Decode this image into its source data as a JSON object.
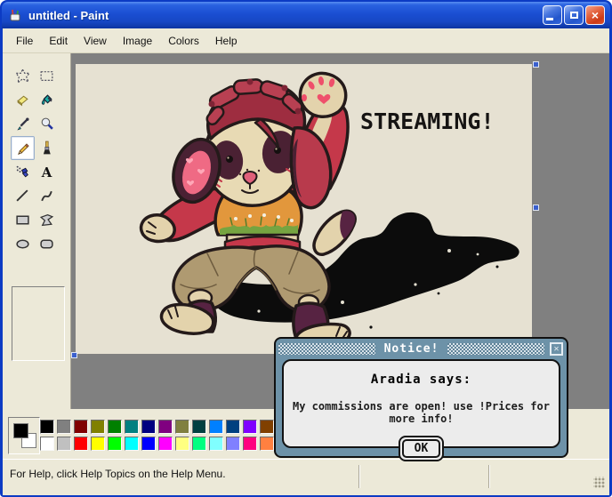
{
  "window": {
    "title": "untitled - Paint",
    "app_icon": "paint-cup-icon",
    "controls": {
      "minimize": "minimize",
      "maximize": "maximize",
      "close": "close"
    }
  },
  "menu": {
    "items": [
      "File",
      "Edit",
      "View",
      "Image",
      "Colors",
      "Help"
    ]
  },
  "tools": {
    "selected_tool": "pencil",
    "items": [
      {
        "icon": "free-form-select-icon"
      },
      {
        "icon": "select-icon"
      },
      {
        "icon": "eraser-icon"
      },
      {
        "icon": "fill-with-color-icon"
      },
      {
        "icon": "pick-color-icon"
      },
      {
        "icon": "magnifier-icon"
      },
      {
        "icon": "pencil-icon"
      },
      {
        "icon": "brush-icon"
      },
      {
        "icon": "airbrush-icon"
      },
      {
        "icon": "text-icon"
      },
      {
        "icon": "line-icon"
      },
      {
        "icon": "curve-icon"
      },
      {
        "icon": "rectangle-icon"
      },
      {
        "icon": "polygon-icon"
      },
      {
        "icon": "ellipse-icon"
      },
      {
        "icon": "rounded-rectangle-icon"
      }
    ]
  },
  "canvas": {
    "overlay_text": "STREAMING!",
    "background": "#e6e1d2",
    "artwork": "anthro dog character waving with heart paw pad, orange crop top, khaki pants, black shadow"
  },
  "palette": {
    "foreground": "#000000",
    "background": "#ffffff",
    "row1": [
      "#000000",
      "#808080",
      "#800000",
      "#808000",
      "#008000",
      "#008080",
      "#000080",
      "#800080",
      "#808040",
      "#004040",
      "#0080ff",
      "#004080",
      "#8000ff",
      "#804000"
    ],
    "row2": [
      "#ffffff",
      "#c0c0c0",
      "#ff0000",
      "#ffff00",
      "#00ff00",
      "#00ffff",
      "#0000ff",
      "#ff00ff",
      "#ffff80",
      "#00ff80",
      "#80ffff",
      "#8080ff",
      "#ff0080",
      "#ff8040"
    ]
  },
  "dialog": {
    "title": "Notice!",
    "close_glyph": "✕",
    "heading": "Aradia says:",
    "message": "My commissions are open! use !Prices for more info!",
    "ok_label": "OK"
  },
  "status_bar": {
    "text": "For Help, click Help Topics on the Help Menu."
  },
  "colors": {
    "titlebar_blue": "#1a4ed2",
    "window_border_blue": "#0c3bc4",
    "chrome_beige": "#ece9d8",
    "workspace_gray": "#808080",
    "canvas_cream": "#e6e1d2",
    "dialog_steel_blue": "#6d92a8",
    "dialog_panel_gray": "#ececec"
  }
}
